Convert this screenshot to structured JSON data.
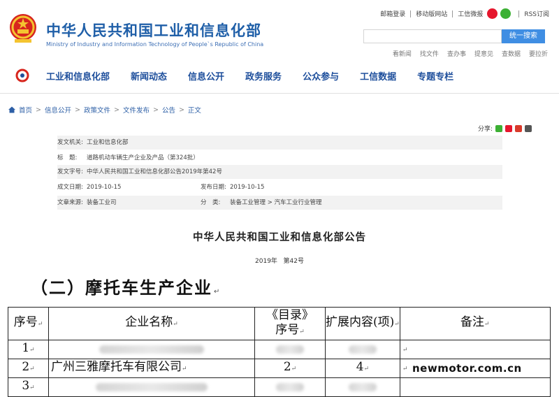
{
  "header": {
    "site_title": "中华人民共和国工业和信息化部",
    "site_subtitle": "Ministry of Industry and Information Technology of People`s Republic of China",
    "top_links": [
      "邮箱登录",
      "移动版网站",
      "工信微报",
      "RSS订阅"
    ],
    "search": {
      "placeholder": "",
      "button_label": "统一搜索"
    },
    "quick_links": [
      "看新闻",
      "找文件",
      "查办事",
      "提意见",
      "查数据",
      "要拉折"
    ]
  },
  "nav": {
    "items": [
      "工业和信息化部",
      "新闻动态",
      "信息公开",
      "政务服务",
      "公众参与",
      "工信数据",
      "专题专栏"
    ]
  },
  "breadcrumb": {
    "items": [
      "首页",
      "信息公开",
      "政策文件",
      "文件发布",
      "公告",
      "正文"
    ],
    "separator": ">"
  },
  "share": {
    "label": "分享:"
  },
  "meta": {
    "issuer_label": "发文机关:",
    "issuer_value": "工业和信息化部",
    "title_label": "标　题:",
    "title_value": "道路机动车辆生产企业及产品（第324批）",
    "docno_label": "发文字号:",
    "docno_value": "中华人民共和国工业和信息化部公告2019年第42号",
    "written_label": "成文日期:",
    "written_value": "2019-10-15",
    "published_label": "发布日期:",
    "published_value": "2019-10-15",
    "source_label": "文章来源:",
    "source_value": "装备工业司",
    "category_label": "分　类:",
    "category_value": "装备工业管理 > 汽车工业行业管理"
  },
  "announcement": {
    "title": "中华人民共和国工业和信息化部公告",
    "number": "2019年   第42号"
  },
  "section": {
    "heading": "（二）摩托车生产企业",
    "mark": "↵"
  },
  "table": {
    "headers": {
      "seq": "序号",
      "name": "企业名称",
      "catalog_top": "《目录》",
      "catalog_bottom": "序号",
      "ext": "扩展内容(项)",
      "note": "备注"
    },
    "rows": [
      {
        "seq": "1",
        "name": "",
        "catalog": "",
        "ext": "",
        "note": ""
      },
      {
        "seq": "2",
        "name": "广州三雅摩托车有限公司",
        "catalog": "2",
        "ext": "4",
        "note": ""
      },
      {
        "seq": "3",
        "name": "",
        "catalog": "",
        "ext": "",
        "note": ""
      }
    ],
    "cell_mark": "↵"
  },
  "watermark": "newmotor.com.cn"
}
